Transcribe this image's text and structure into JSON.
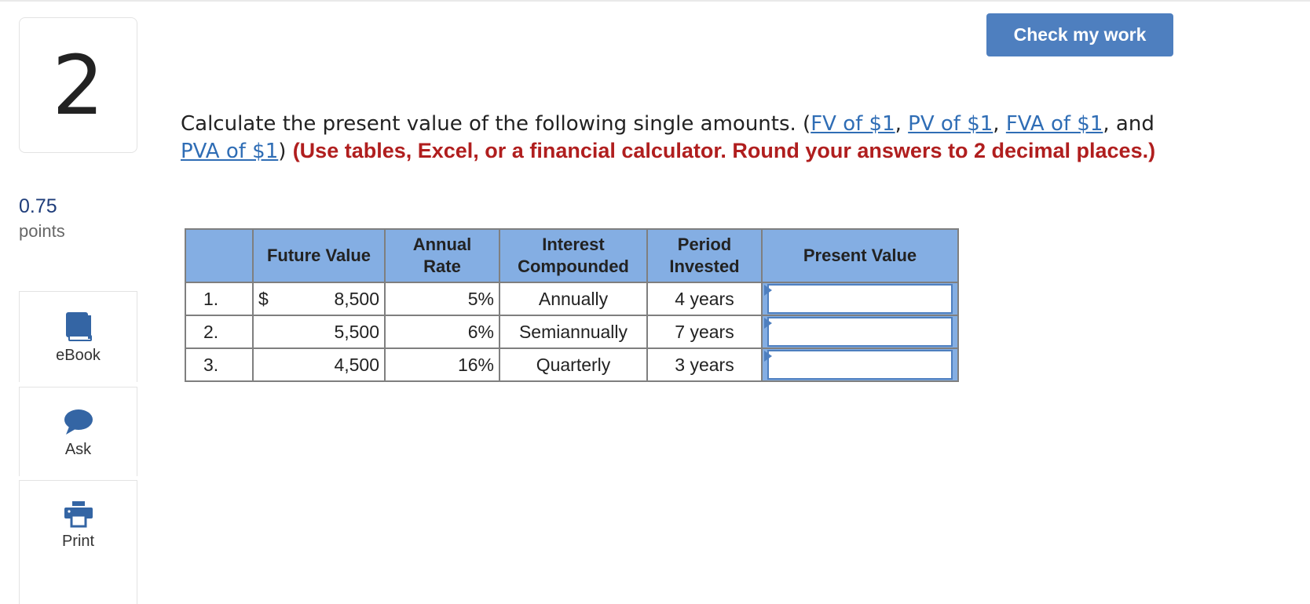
{
  "question": {
    "number": "2",
    "points_value": "0.75",
    "points_label": "points",
    "text_before": "Calculate the present value of the following single amounts. (",
    "links": [
      "FV of $1",
      "PV of $1",
      "FVA of $1",
      "PVA of $1"
    ],
    "sep_comma": ", ",
    "sep_and": ", and ",
    "text_after_links": ") ",
    "instruction": "(Use tables, Excel, or a financial calculator. Round your answers to 2 decimal places.)"
  },
  "toolbar": {
    "check_label": "Check my work",
    "ebook_label": "eBook",
    "ask_label": "Ask",
    "print_label": "Print"
  },
  "table": {
    "headers": {
      "future_value": "Future Value",
      "annual_rate_1": "Annual",
      "annual_rate_2": "Rate",
      "interest_1": "Interest",
      "interest_2": "Compounded",
      "period_1": "Period",
      "period_2": "Invested",
      "present_value": "Present Value"
    },
    "currency_symbol": "$",
    "rows": [
      {
        "num": "1.",
        "future_value": "8,500",
        "rate": "5%",
        "compounded": "Annually",
        "period": "4 years",
        "present_value": ""
      },
      {
        "num": "2.",
        "future_value": "5,500",
        "rate": "6%",
        "compounded": "Semiannually",
        "period": "7 years",
        "present_value": ""
      },
      {
        "num": "3.",
        "future_value": "4,500",
        "rate": "16%",
        "compounded": "Quarterly",
        "period": "3 years",
        "present_value": ""
      }
    ]
  },
  "colors": {
    "accent": "#4e7fbf",
    "header_fill": "#84aee3",
    "instruction_red": "#b01e1e",
    "link_blue": "#2f6db5"
  },
  "icons": [
    "book-icon",
    "chat-bubble-icon",
    "printer-icon"
  ]
}
